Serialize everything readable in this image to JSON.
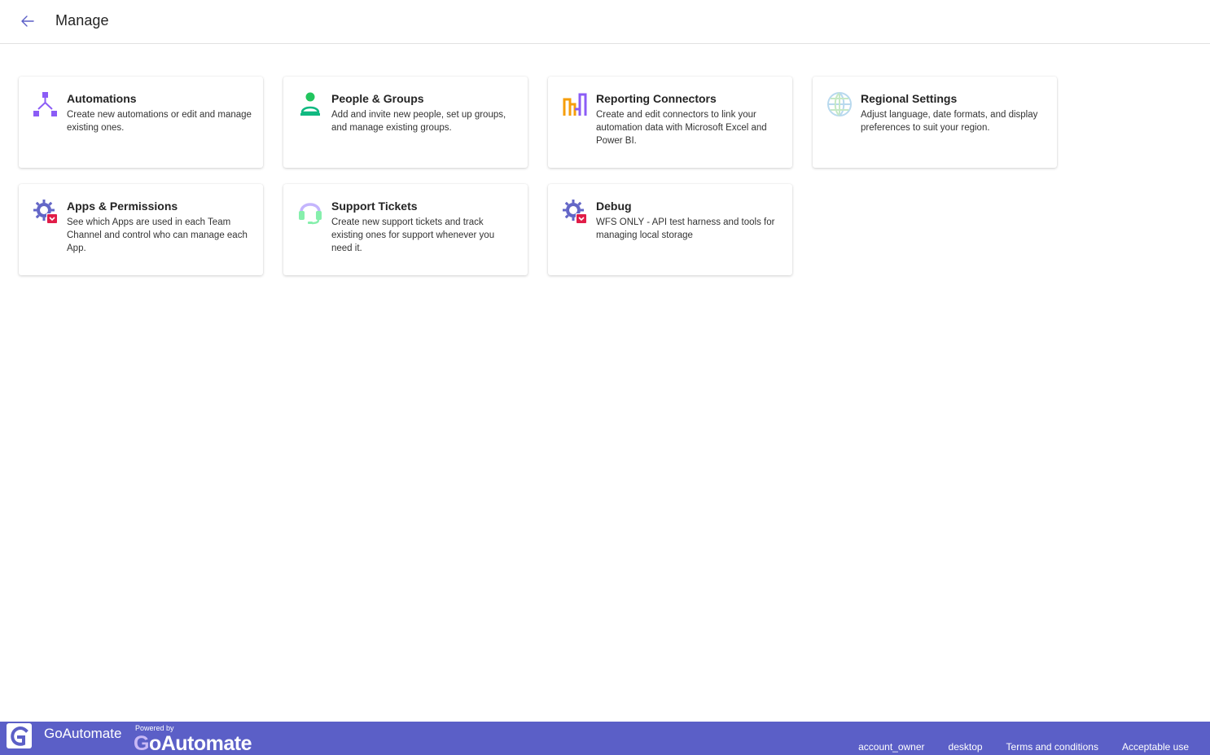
{
  "header": {
    "title": "Manage",
    "back_icon": "back-arrow-icon"
  },
  "cards": [
    {
      "title": "Automations",
      "description": "Create new automations or edit and manage existing ones.",
      "icon": "automations-icon"
    },
    {
      "title": "People & Groups",
      "description": "Add and invite new people, set up groups, and manage existing groups.",
      "icon": "people-icon"
    },
    {
      "title": "Reporting Connectors",
      "description": "Create and edit connectors to link your automation data with Microsoft Excel and Power BI.",
      "icon": "reporting-icon"
    },
    {
      "title": "Regional Settings",
      "description": "Adjust language, date formats, and display preferences to suit your region.",
      "icon": "globe-icon"
    },
    {
      "title": "Apps & Permissions",
      "description": "See which Apps are used in each Team Channel and control who can manage each App.",
      "icon": "gear-shield-icon"
    },
    {
      "title": "Support Tickets",
      "description": "Create new support tickets and track existing ones for support whenever you need it.",
      "icon": "headset-icon"
    },
    {
      "title": "Debug",
      "description": "WFS ONLY - API test harness and tools for managing local storage",
      "icon": "gear-shield-icon"
    }
  ],
  "footer": {
    "app_name": "GoAutomate",
    "powered_by": "Powered by",
    "brand_g": "G",
    "brand_rest": "oAutomate",
    "links": [
      "account_owner",
      "desktop",
      "Terms and conditions",
      "Acceptable use"
    ]
  },
  "colors": {
    "accent": "#5b5fc7",
    "automations": "#8b5cf6",
    "people": "#22c55e",
    "people_base": "#10b981",
    "reporting_orange": "#f59e0b",
    "reporting_purple": "#8b5cf6",
    "globe": "#b8d9ee",
    "gear": "#6366c7",
    "shield": "#e11d48",
    "headset_top": "#c4b5fd",
    "headset_bottom": "#86efac"
  }
}
